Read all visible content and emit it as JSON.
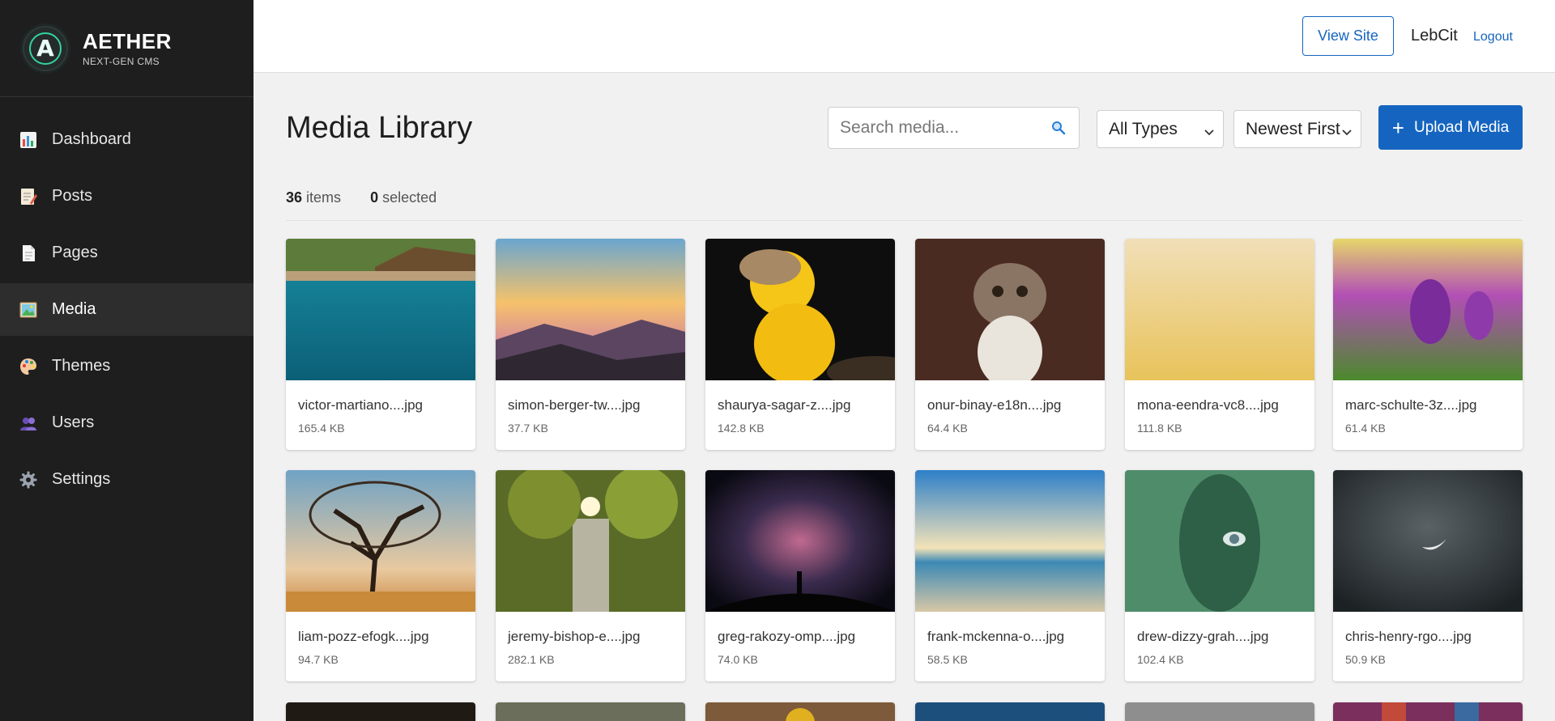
{
  "brand": {
    "name": "AETHER",
    "tagline": "NEXT-GEN CMS",
    "logo_letter": "A"
  },
  "nav": [
    {
      "label": "Dashboard",
      "icon": "chart-icon"
    },
    {
      "label": "Posts",
      "icon": "memo-icon"
    },
    {
      "label": "Pages",
      "icon": "page-icon"
    },
    {
      "label": "Media",
      "icon": "picture-icon",
      "active": true
    },
    {
      "label": "Themes",
      "icon": "palette-icon"
    },
    {
      "label": "Users",
      "icon": "users-icon"
    },
    {
      "label": "Settings",
      "icon": "gear-icon"
    }
  ],
  "topbar": {
    "view_site": "View Site",
    "username": "LebCit",
    "logout": "Logout"
  },
  "page": {
    "title": "Media Library",
    "search_placeholder": "Search media...",
    "type_filter": "All Types",
    "sort": "Newest First",
    "upload_label": "Upload Media",
    "item_count": "36",
    "item_count_label": "items",
    "selected_count": "0",
    "selected_label": "selected"
  },
  "media": [
    {
      "name": "victor-martiano....jpg",
      "size": "165.4 KB"
    },
    {
      "name": "simon-berger-tw....jpg",
      "size": "37.7 KB"
    },
    {
      "name": "shaurya-sagar-z....jpg",
      "size": "142.8 KB"
    },
    {
      "name": "onur-binay-e18n....jpg",
      "size": "64.4 KB"
    },
    {
      "name": "mona-eendra-vc8....jpg",
      "size": "111.8 KB"
    },
    {
      "name": "marc-schulte-3z....jpg",
      "size": "61.4 KB"
    },
    {
      "name": "liam-pozz-efogk....jpg",
      "size": "94.7 KB"
    },
    {
      "name": "jeremy-bishop-e....jpg",
      "size": "282.1 KB"
    },
    {
      "name": "greg-rakozy-omp....jpg",
      "size": "74.0 KB"
    },
    {
      "name": "frank-mckenna-o....jpg",
      "size": "58.5 KB"
    },
    {
      "name": "drew-dizzy-grah....jpg",
      "size": "102.4 KB"
    },
    {
      "name": "chris-henry-rgo....jpg",
      "size": "50.9 KB"
    }
  ],
  "colors": {
    "accent": "#1565c0",
    "sidebar_bg": "#1e1e1e",
    "sidebar_active": "#2d2d2d",
    "page_bg": "#f1f1f1"
  }
}
